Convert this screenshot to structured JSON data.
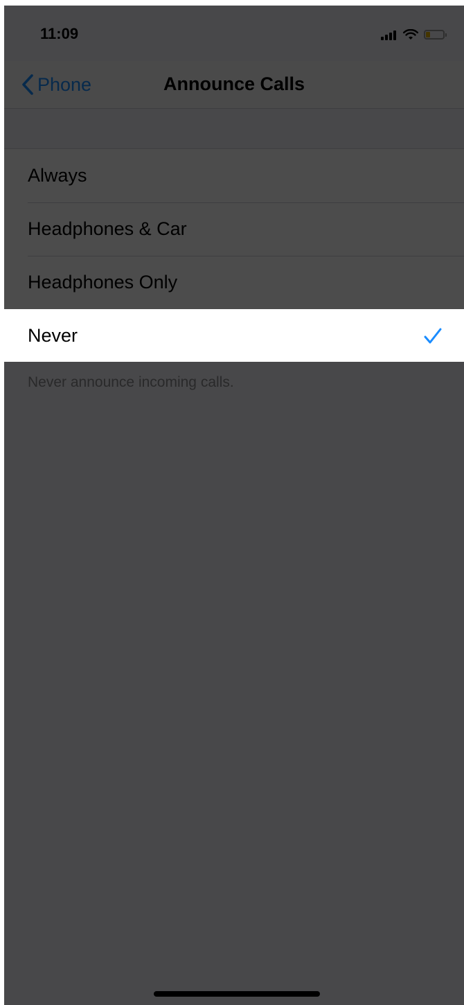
{
  "status_bar": {
    "time": "11:09",
    "battery_level_fraction": 0.25,
    "battery_color": "#e3b100"
  },
  "nav": {
    "back_label": "Phone",
    "back_icon": "chevron-left-icon",
    "title": "Announce Calls"
  },
  "options": [
    {
      "label": "Always",
      "selected": false
    },
    {
      "label": "Headphones & Car",
      "selected": false
    },
    {
      "label": "Headphones Only",
      "selected": false
    },
    {
      "label": "Never",
      "selected": true
    }
  ],
  "footer_note": "Never announce incoming calls.",
  "colors": {
    "accent": "#1a8cff",
    "background": "#f2f2f7",
    "overlay": "#4a4a4c"
  }
}
